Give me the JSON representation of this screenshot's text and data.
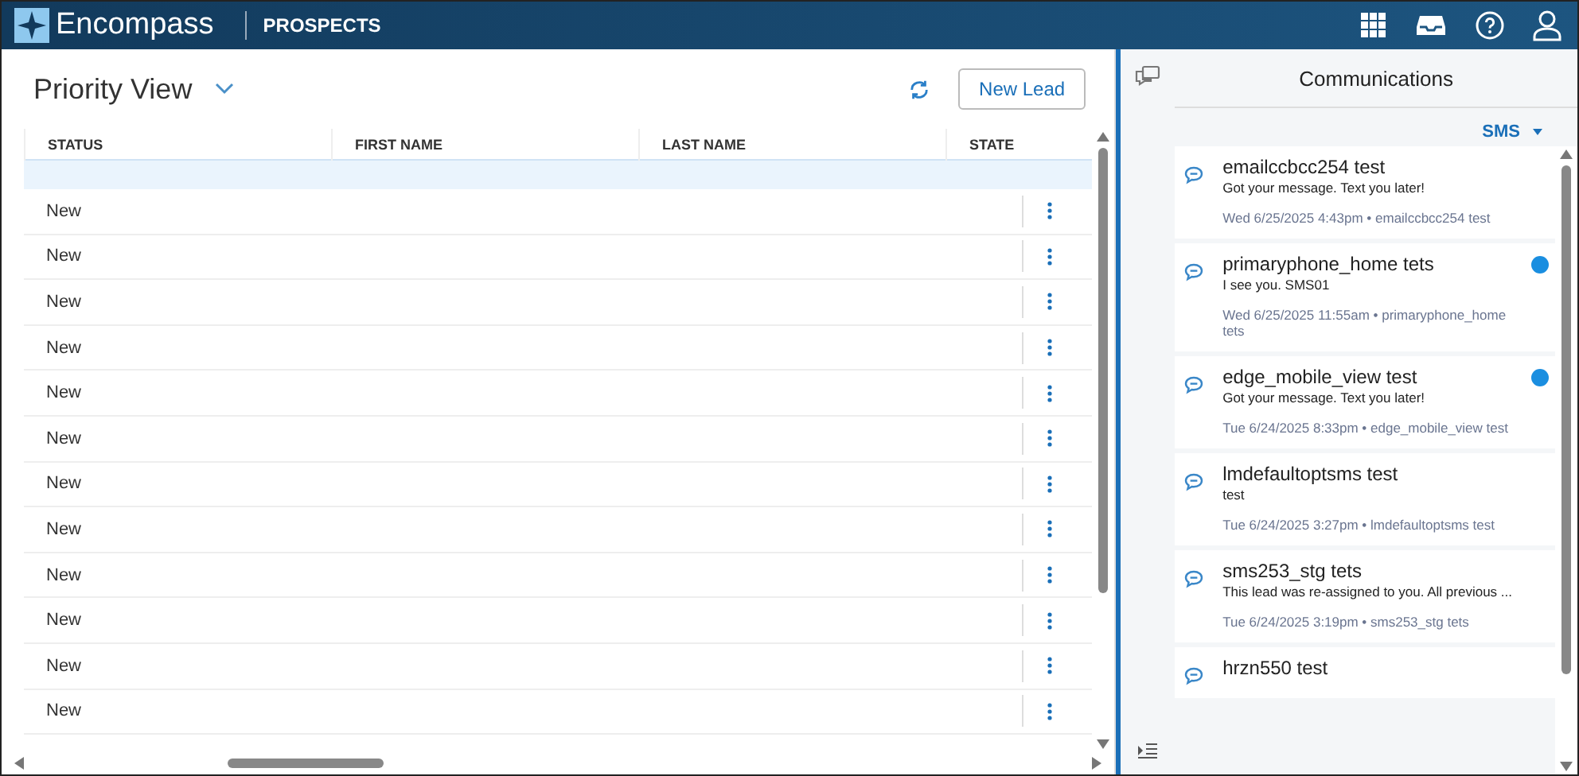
{
  "app_bar": {
    "brand": "Encompass",
    "section": "PROSPECTS"
  },
  "view": {
    "title": "Priority View",
    "new_lead_button": "New Lead"
  },
  "table": {
    "columns": [
      "STATUS",
      "FIRST NAME",
      "LAST NAME",
      "STATE"
    ],
    "rows": [
      {
        "status": "New"
      },
      {
        "status": "New"
      },
      {
        "status": "New"
      },
      {
        "status": "New"
      },
      {
        "status": "New"
      },
      {
        "status": "New"
      },
      {
        "status": "New"
      },
      {
        "status": "New"
      },
      {
        "status": "New"
      },
      {
        "status": "New"
      },
      {
        "status": "New"
      },
      {
        "status": "New"
      }
    ]
  },
  "communications": {
    "title": "Communications",
    "filter": "SMS",
    "items": [
      {
        "name": "emailccbcc254 test",
        "message": "Got your message. Text you later!",
        "meta": "Wed 6/25/2025 4:43pm • emailccbcc254 test",
        "unread": false
      },
      {
        "name": "primaryphone_home tets",
        "message": "I see you. SMS01",
        "meta": "Wed 6/25/2025 11:55am • primaryphone_home tets",
        "unread": true
      },
      {
        "name": "edge_mobile_view test",
        "message": "Got your message. Text you later!",
        "meta": "Tue 6/24/2025 8:33pm • edge_mobile_view test",
        "unread": true
      },
      {
        "name": "lmdefaultoptsms test",
        "message": "test",
        "meta": "Tue 6/24/2025 3:27pm • lmdefaultoptsms test",
        "unread": false
      },
      {
        "name": "sms253_stg tets",
        "message": "This lead was re-assigned to you. All previous ...",
        "meta": "Tue 6/24/2025 3:19pm • sms253_stg tets",
        "unread": false
      },
      {
        "name": "hrzn550 test",
        "unread": false
      }
    ]
  }
}
